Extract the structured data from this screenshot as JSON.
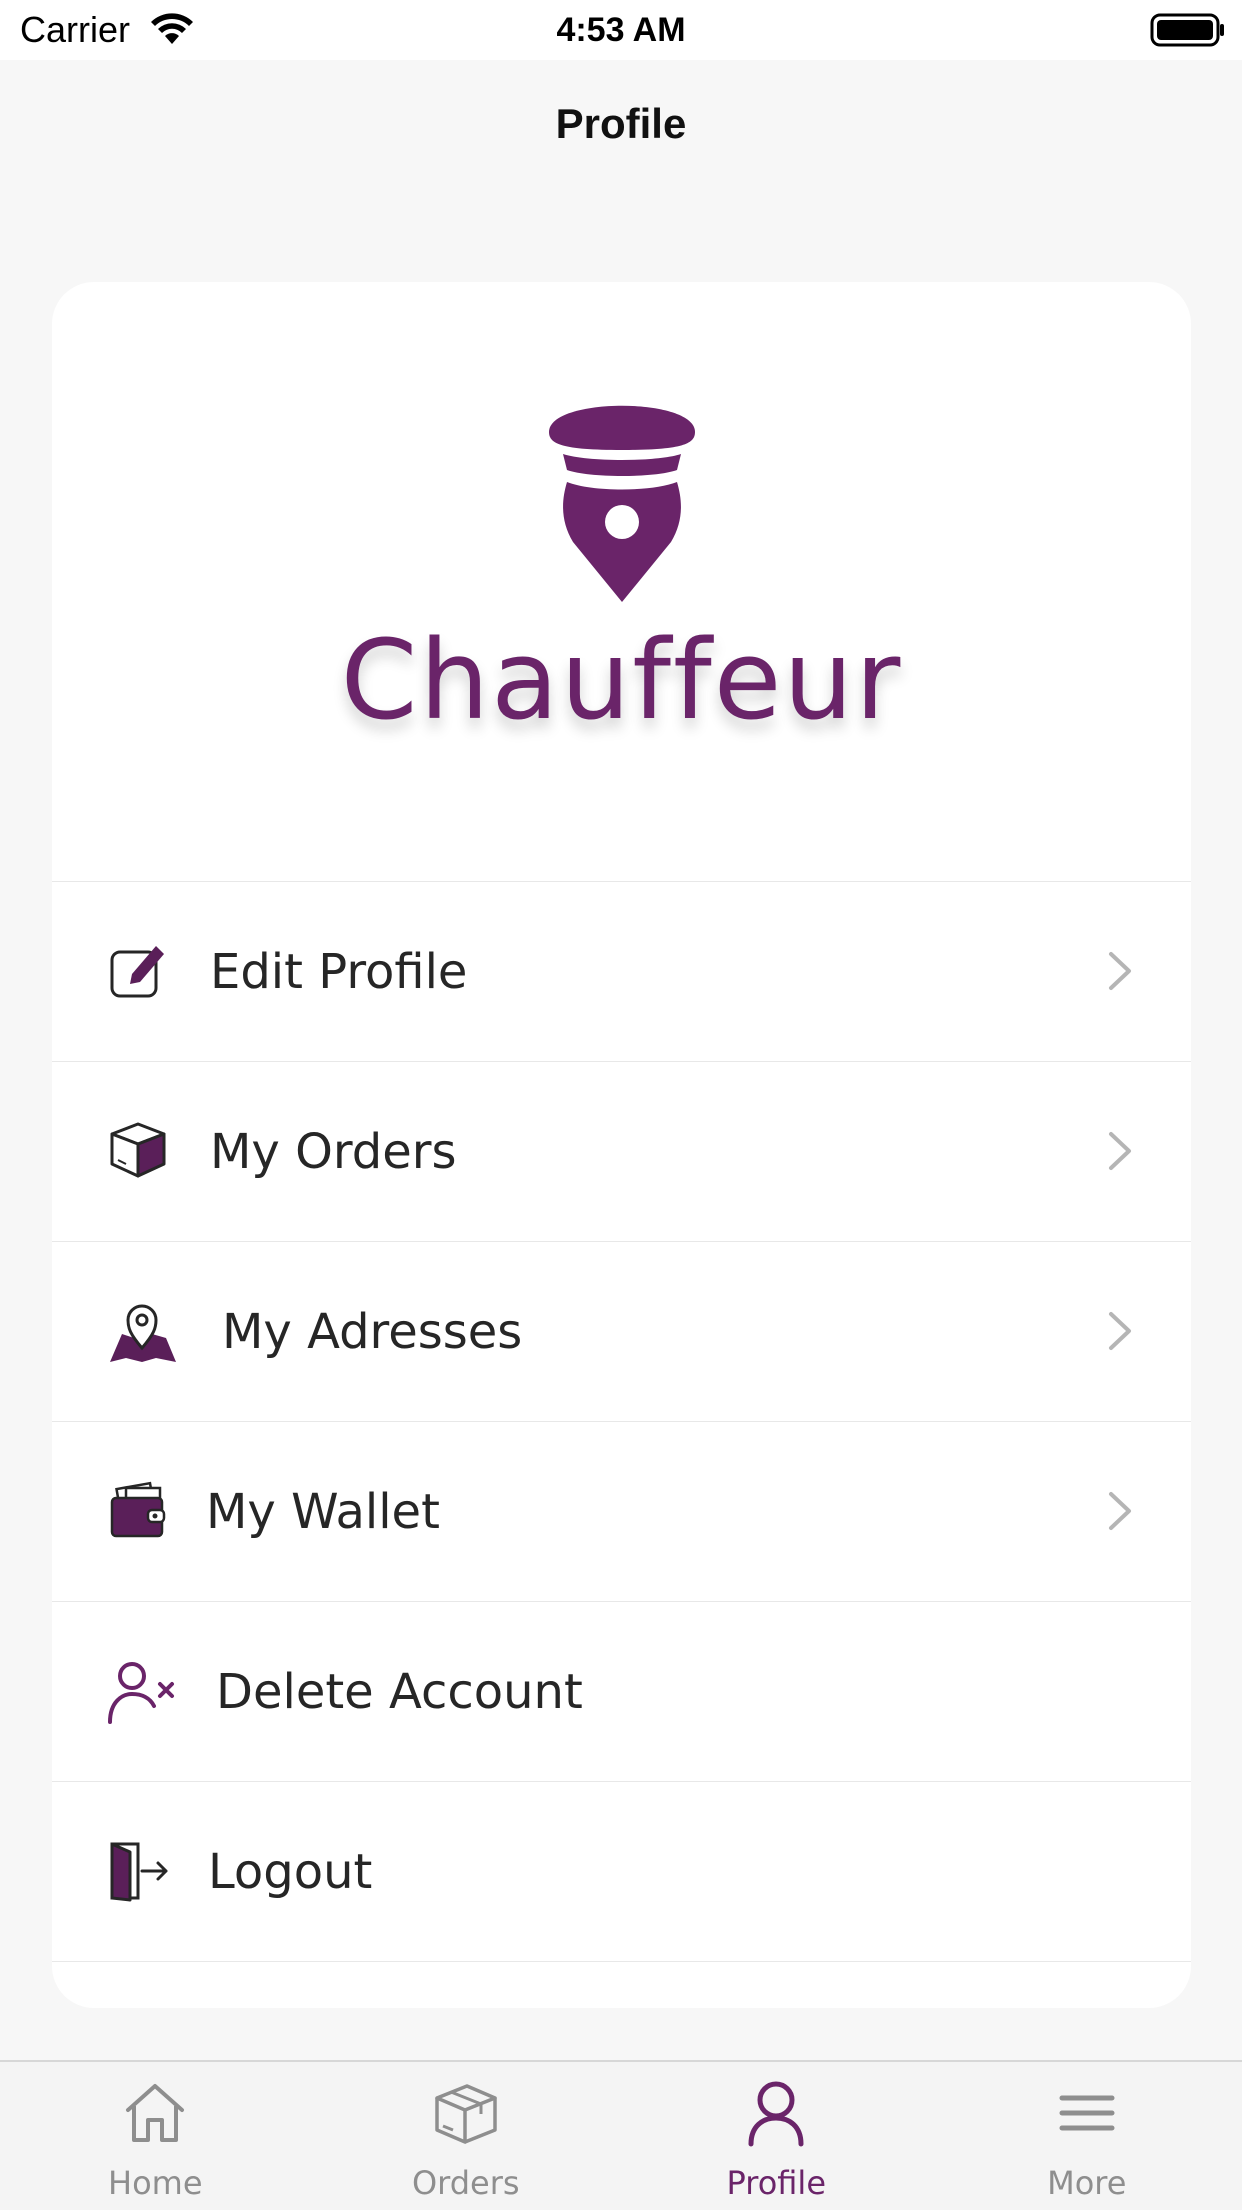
{
  "status_bar": {
    "carrier": "Carrier",
    "time": "4:53 AM"
  },
  "nav": {
    "title": "Profile"
  },
  "logo": {
    "wordmark": "Chauffeur",
    "brand_color": "#6a2469"
  },
  "menu": {
    "items": [
      {
        "label": "Edit Profile",
        "icon": "edit-icon",
        "chevron": true
      },
      {
        "label": "My Orders",
        "icon": "box-icon",
        "chevron": true
      },
      {
        "label": "My Adresses",
        "icon": "map-pin-icon",
        "chevron": true
      },
      {
        "label": "My Wallet",
        "icon": "wallet-icon",
        "chevron": true
      },
      {
        "label": "Delete Account",
        "icon": "user-remove-icon",
        "chevron": false
      },
      {
        "label": "Logout",
        "icon": "logout-icon",
        "chevron": false
      }
    ]
  },
  "tab_bar": {
    "active": "Profile",
    "active_color": "#6a2469",
    "inactive_color": "#8e8e8e",
    "tabs": [
      {
        "label": "Home",
        "icon": "home-icon"
      },
      {
        "label": "Orders",
        "icon": "box-icon"
      },
      {
        "label": "Profile",
        "icon": "person-icon"
      },
      {
        "label": "More",
        "icon": "menu-icon"
      }
    ]
  }
}
